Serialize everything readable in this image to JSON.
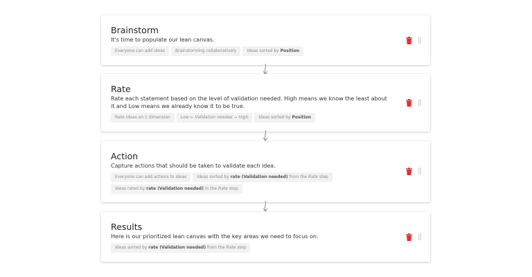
{
  "colors": {
    "delete": "#e2312f",
    "chip_bg": "#f2f2f3",
    "arrow": "#8a8a8a"
  },
  "icons": {
    "delete": "trash-icon",
    "drag": "drag-handle-icon",
    "connector": "arrow-down-icon"
  },
  "steps": [
    {
      "title": "Brainstorm",
      "description": "It's time to populate our lean canvas.",
      "chips": [
        {
          "parts": [
            {
              "t": "Everyone can add ideas"
            }
          ]
        },
        {
          "parts": [
            {
              "t": "Brainstorming collaboratively"
            }
          ]
        },
        {
          "parts": [
            {
              "t": "Ideas sorted by "
            },
            {
              "t": "Position",
              "b": true
            }
          ]
        }
      ]
    },
    {
      "title": "Rate",
      "description": "Rate each statement based on the level of validation needed. High means we know the least about it and Low means we already know it to be true.",
      "chips": [
        {
          "parts": [
            {
              "t": "Rate ideas on 1 dimension"
            }
          ]
        },
        {
          "parts": [
            {
              "t": "Low ← Validation needed → High",
              "i": true
            }
          ]
        },
        {
          "parts": [
            {
              "t": "Ideas sorted by "
            },
            {
              "t": "Position",
              "b": true
            }
          ]
        }
      ]
    },
    {
      "title": "Action",
      "description": "Capture actions that should be taken to validate each idea.",
      "chips": [
        {
          "parts": [
            {
              "t": "Everyone can add actions to ideas"
            }
          ]
        },
        {
          "parts": [
            {
              "t": "Ideas sorted by "
            },
            {
              "t": "rate (Validation needed)",
              "b": true
            },
            {
              "t": " from the "
            },
            {
              "t": "Rate",
              "i": true
            },
            {
              "t": " step"
            }
          ]
        },
        {
          "parts": [
            {
              "t": "Ideas rated by "
            },
            {
              "t": "rate (Validation needed)",
              "b": true
            },
            {
              "t": " in the "
            },
            {
              "t": "Rate",
              "i": true
            },
            {
              "t": " step"
            }
          ]
        }
      ]
    },
    {
      "title": "Results",
      "description": "Here is our prioritized lean canvas with the key areas we need to focus on.",
      "chips": [
        {
          "parts": [
            {
              "t": "Ideas sorted by "
            },
            {
              "t": "rate (Validation needed)",
              "b": true
            },
            {
              "t": " from the "
            },
            {
              "t": "Rate",
              "i": true
            },
            {
              "t": " step"
            }
          ]
        }
      ]
    }
  ]
}
